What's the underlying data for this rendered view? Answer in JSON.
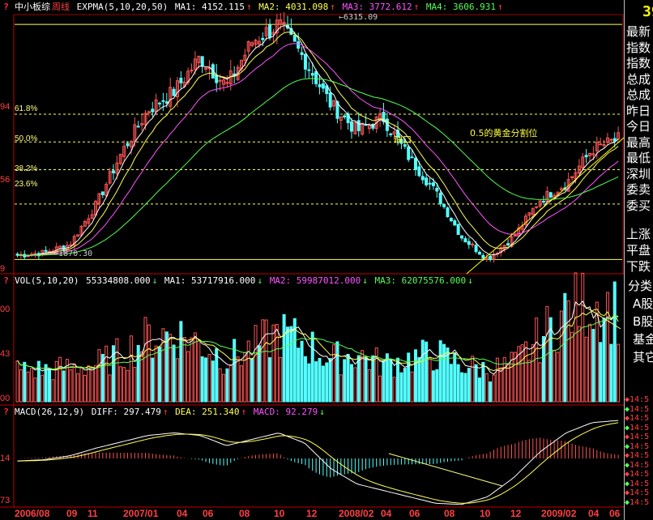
{
  "panel_title": "中小板综",
  "period": "周线",
  "price": {
    "indicator": "EXPMA(5,10,20,50)",
    "ma1": "MA1: 4152.115",
    "ma2": "MA2: 4031.098",
    "ma3": "MA3: 3772.612",
    "ma4": "MA4: 3606.931",
    "high_label": "6315.09",
    "low_label": "1870.30",
    "y_labels": [
      "94",
      "56",
      "9"
    ],
    "fib": [
      "61.8%",
      "50.0%",
      "38.2%",
      "23.6%"
    ],
    "gap_label": "缺口",
    "golden_label": "0.5的黄金分割位"
  },
  "volume": {
    "indicator": "VOL(5,10,20)",
    "value": "55334808.000",
    "ma1": "MA1: 53717916.000",
    "ma2": "MA2: 59987012.000",
    "ma3": "MA3: 62075576.000",
    "y_labels": [
      "00",
      "43",
      "00"
    ]
  },
  "macd": {
    "indicator": "MACD(26,12,9)",
    "diff": "DIFF: 297.479",
    "dea": "DEA: 251.340",
    "macd": "MACD: 92.279",
    "y_labels": [
      "14",
      "73"
    ]
  },
  "x_labels": [
    "2006/08",
    "09",
    "11",
    "2007/01",
    "04",
    "06",
    "08",
    "10",
    "12",
    "2008/02",
    "04",
    "06",
    "08",
    "10",
    "12",
    "2009/02",
    "04",
    "06"
  ],
  "right_panel": {
    "big": "39",
    "items": [
      "最新",
      "指数",
      "指数",
      "总成",
      "总成",
      "昨日",
      "今日",
      "最高",
      "最低",
      "深圳",
      "委卖",
      "委买"
    ],
    "items2": [
      "上涨",
      "平盘",
      "下跌"
    ],
    "sectors": [
      "分类",
      "A股",
      "B股",
      "基金",
      "其它"
    ],
    "ticks": [
      "14:5",
      "14:5",
      "14:5",
      "14:5",
      "14:5",
      "14:5",
      "14:5",
      "14:5",
      "14:5",
      "14:5",
      "14:5",
      "14:5"
    ]
  },
  "colors": {
    "up": "#ff5454",
    "down": "#54ffff",
    "ma1": "#ffffff",
    "ma2": "#ffff54",
    "ma3": "#ff54ff",
    "ma4": "#54ff54",
    "fib": "#ffff54",
    "separator": "#a00000"
  },
  "chart_data": {
    "type": "candlestick",
    "title": "中小板综 周线",
    "price_range": [
      1870.3,
      6315.09
    ],
    "fib_levels": [
      {
        "label": "61.8%",
        "value": 4617
      },
      {
        "label": "50.0%",
        "value": 4093
      },
      {
        "label": "38.2%",
        "value": 3568
      },
      {
        "label": "23.6%",
        "value": 2919
      }
    ],
    "keypoints": [
      {
        "date": "2006/08",
        "close": 1950
      },
      {
        "date": "2006/10",
        "close": 2000
      },
      {
        "date": "2006/12",
        "close": 2150
      },
      {
        "date": "2007/02",
        "close": 2900
      },
      {
        "date": "2007/04",
        "close": 3900
      },
      {
        "date": "2007/05",
        "close": 4700
      },
      {
        "date": "2007/07",
        "close": 5050
      },
      {
        "date": "2007/09",
        "close": 5700
      },
      {
        "date": "2007/10",
        "close": 5150
      },
      {
        "date": "2007/12",
        "close": 6000
      },
      {
        "date": "2008/01",
        "close": 6315
      },
      {
        "date": "2008/02",
        "close": 5650
      },
      {
        "date": "2008/03",
        "close": 4800
      },
      {
        "date": "2008/04",
        "close": 4300
      },
      {
        "date": "2008/05",
        "close": 4550
      },
      {
        "date": "2008/06",
        "close": 3800
      },
      {
        "date": "2008/08",
        "close": 3150
      },
      {
        "date": "2008/10",
        "close": 2300
      },
      {
        "date": "2008/11",
        "close": 1880
      },
      {
        "date": "2008/12",
        "close": 2300
      },
      {
        "date": "2009/02",
        "close": 3000
      },
      {
        "date": "2009/03",
        "close": 3300
      },
      {
        "date": "2009/05",
        "close": 3950
      },
      {
        "date": "2009/06",
        "close": 4150
      }
    ],
    "volume_keypoints": [
      30,
      30,
      32,
      35,
      45,
      60,
      65,
      55,
      40,
      50,
      65,
      55,
      40,
      45,
      35,
      40,
      45,
      35,
      30,
      35,
      60,
      85,
      95,
      85
    ],
    "macd_keypoints": [
      -20,
      -10,
      20,
      80,
      130,
      180,
      200,
      180,
      100,
      150,
      200,
      120,
      -80,
      -200,
      -250,
      -300,
      -350,
      -360,
      -300,
      -150,
      50,
      200,
      280,
      297
    ]
  }
}
